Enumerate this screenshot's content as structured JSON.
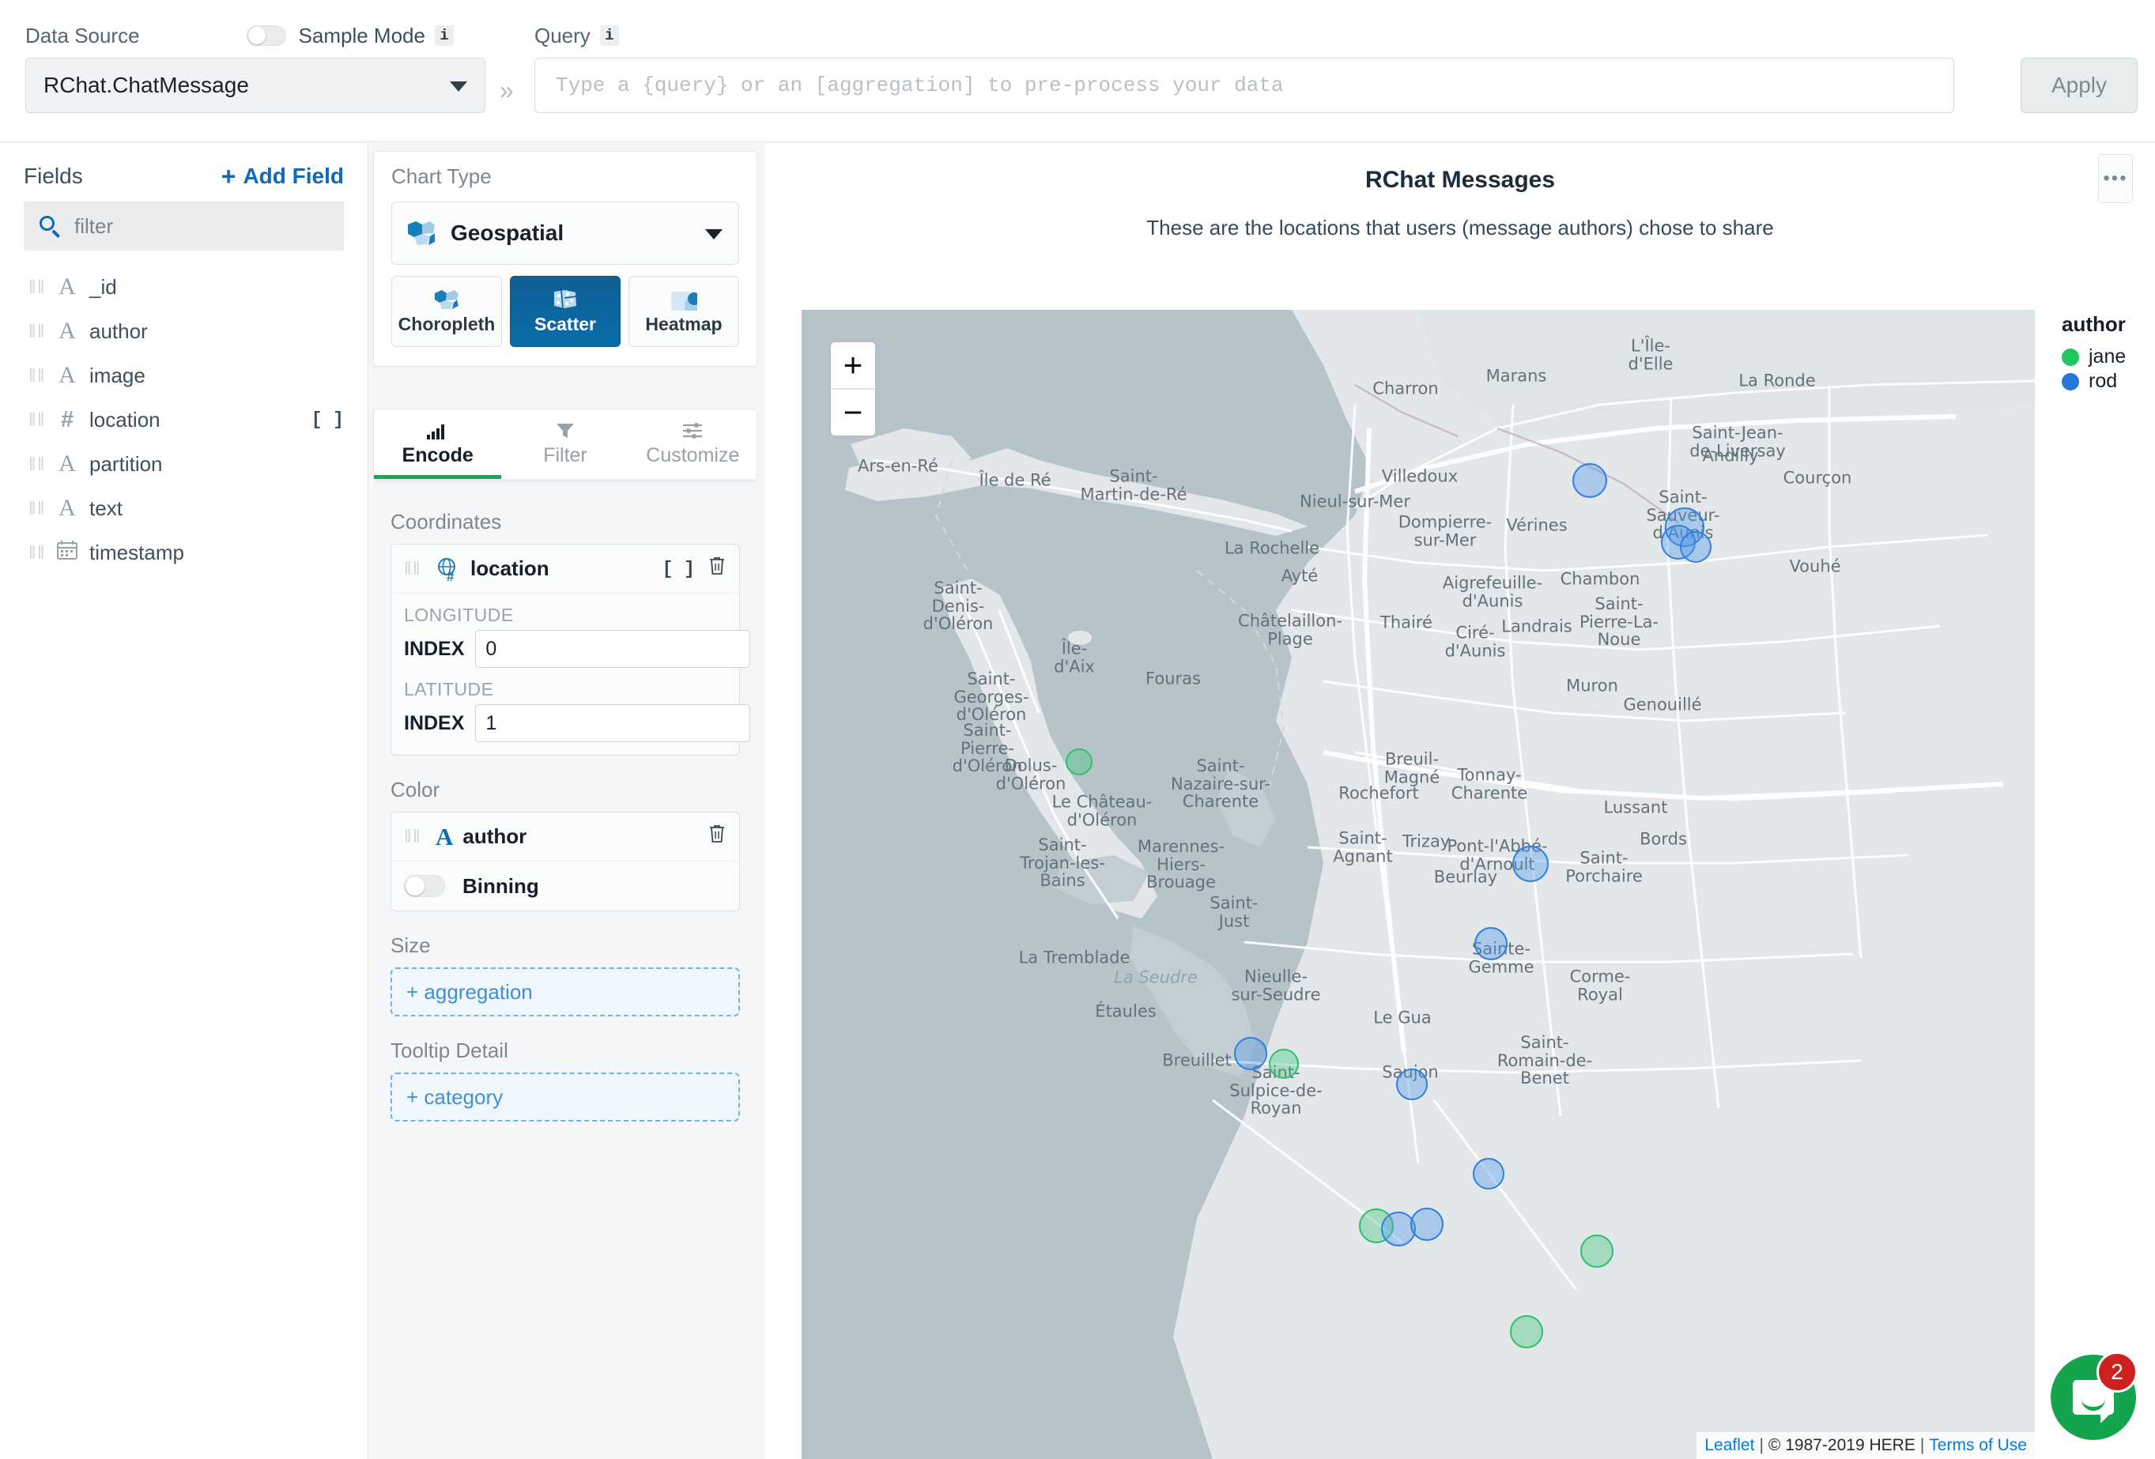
{
  "topbar": {
    "data_source_label": "Data Source",
    "sample_mode_label": "Sample Mode",
    "sample_mode_on": false,
    "info_glyph": "i",
    "data_source_value": "RChat.ChatMessage",
    "chevron_glyph": "»",
    "query_label": "Query",
    "query_value": "",
    "query_placeholder": "Type a {query} or an [aggregation] to pre-process your data",
    "apply_label": "Apply"
  },
  "fields": {
    "title": "Fields",
    "add_field_label": "Add Field",
    "plus_glyph": "+",
    "filter_placeholder": "filter",
    "grip_glyph": "‖‖",
    "items": [
      {
        "name": "_id",
        "type_glyph": "A",
        "type_class": "serif",
        "array": ""
      },
      {
        "name": "author",
        "type_glyph": "A",
        "type_class": "serif",
        "array": ""
      },
      {
        "name": "image",
        "type_glyph": "A",
        "type_class": "serif",
        "array": ""
      },
      {
        "name": "location",
        "type_glyph": "#",
        "type_class": "hash",
        "array": "[ ]"
      },
      {
        "name": "partition",
        "type_glyph": "A",
        "type_class": "serif",
        "array": ""
      },
      {
        "name": "text",
        "type_glyph": "A",
        "type_class": "serif",
        "array": ""
      },
      {
        "name": "timestamp",
        "type_glyph": "▦",
        "type_class": "cal",
        "array": ""
      }
    ]
  },
  "chart_type": {
    "title": "Chart Type",
    "selected": "Geospatial",
    "options": [
      {
        "label": "Choropleth",
        "active": false
      },
      {
        "label": "Scatter",
        "active": true
      },
      {
        "label": "Heatmap",
        "active": false
      }
    ]
  },
  "tabs": [
    {
      "label": "Encode",
      "active": true
    },
    {
      "label": "Filter",
      "active": false
    },
    {
      "label": "Customize",
      "active": false
    }
  ],
  "encode": {
    "coordinates_title": "Coordinates",
    "coord_field": "location",
    "coord_array_glyph": "[ ]",
    "trash_glyph": "🗑",
    "longitude_label": "LONGITUDE",
    "longitude_index_label": "INDEX",
    "longitude_index_value": "0",
    "latitude_label": "LATITUDE",
    "latitude_index_label": "INDEX",
    "latitude_index_value": "1",
    "color_title": "Color",
    "color_field": "author",
    "binning_label": "Binning",
    "binning_on": false,
    "size_title": "Size",
    "size_placeholder": "+ aggregation",
    "tooltip_title": "Tooltip Detail",
    "tooltip_placeholder": "+ category"
  },
  "chart": {
    "title": "RChat Messages",
    "subtitle": "These are the locations that users (message authors) chose to share",
    "menu_glyph": "•••",
    "zoom_in": "+",
    "zoom_out": "−"
  },
  "legend": {
    "title": "author",
    "items": [
      {
        "label": "jane",
        "color": "#22c55e"
      },
      {
        "label": "rod",
        "color": "#2576dd"
      }
    ]
  },
  "attribution": {
    "leaflet": "Leaflet",
    "copyright": "© 1987-2019 HERE",
    "terms": "Terms of Use",
    "sep": "|"
  },
  "chat_widget": {
    "badge_count": "2"
  },
  "chart_data": {
    "type": "scatter",
    "title": "RChat Messages",
    "subtitle": "These are the locations that users (message authors) chose to share",
    "legend_title": "author",
    "legend_position": "right",
    "series": [
      {
        "name": "jane",
        "color": "#22c55e"
      },
      {
        "name": "rod",
        "color": "#2576dd"
      }
    ],
    "basemap": "HERE streets (grayscale)",
    "points": [
      {
        "author": "rod",
        "x": 0.059,
        "y": 0.1555,
        "r": 22
      },
      {
        "author": "rod",
        "x": 0.0805,
        "y": 0.175,
        "r": 25
      },
      {
        "author": "rod",
        "x": 0.079,
        "y": 0.181,
        "r": 22
      },
      {
        "author": "rod",
        "x": 0.083,
        "y": 0.183,
        "r": 20
      },
      {
        "author": "jane",
        "x": -0.057,
        "y": 0.272,
        "r": 17
      },
      {
        "author": "rod",
        "x": 0.0455,
        "y": 0.314,
        "r": 23
      },
      {
        "author": "rod",
        "x": 0.0365,
        "y": 0.347,
        "r": 21
      },
      {
        "author": "jane",
        "x": -0.0105,
        "y": 0.3965,
        "r": 19
      },
      {
        "author": "rod",
        "x": -0.018,
        "y": 0.3925,
        "r": 21
      },
      {
        "author": "rod",
        "x": 0.0185,
        "y": 0.405,
        "r": 20
      },
      {
        "author": "rod",
        "x": 0.036,
        "y": 0.442,
        "r": 20
      },
      {
        "author": "jane",
        "x": 0.0105,
        "y": 0.4635,
        "r": 22
      },
      {
        "author": "rod",
        "x": 0.0155,
        "y": 0.465,
        "r": 22
      },
      {
        "author": "rod",
        "x": 0.022,
        "y": 0.463,
        "r": 21
      },
      {
        "author": "jane",
        "x": 0.0605,
        "y": 0.474,
        "r": 21
      },
      {
        "author": "jane",
        "x": 0.0445,
        "y": 0.5075,
        "r": 21
      }
    ],
    "map_labels": [
      {
        "t": "Ars-en-Ré",
        "x": 122,
        "y": 198
      },
      {
        "t": "Île de Ré",
        "x": 270,
        "y": 216
      },
      {
        "t": "Saint-\nMartin-de-Ré",
        "x": 420,
        "y": 222
      },
      {
        "t": "Charron",
        "x": 764,
        "y": 100
      },
      {
        "t": "Marans",
        "x": 904,
        "y": 84
      },
      {
        "t": "L'Île-\nd'Elle",
        "x": 1074,
        "y": 57
      },
      {
        "t": "La Ronde",
        "x": 1234,
        "y": 90
      },
      {
        "t": "Saint-Jean-\nde-Liversay",
        "x": 1184,
        "y": 167
      },
      {
        "t": "Andilly",
        "x": 1175,
        "y": 185
      },
      {
        "t": "Villedoux",
        "x": 782,
        "y": 211
      },
      {
        "t": "Courçon",
        "x": 1285,
        "y": 213
      },
      {
        "t": "Nieul-sur-Mer",
        "x": 700,
        "y": 243
      },
      {
        "t": "Dompierre-\nsur-Mer",
        "x": 814,
        "y": 280
      },
      {
        "t": "Vérines",
        "x": 930,
        "y": 273
      },
      {
        "t": "Saint-\nSauveur-\nd'Aunis",
        "x": 1115,
        "y": 260
      },
      {
        "t": "La Rochelle",
        "x": 595,
        "y": 302
      },
      {
        "t": "Ayté",
        "x": 630,
        "y": 337
      },
      {
        "t": "Vouhé",
        "x": 1282,
        "y": 325
      },
      {
        "t": "Aigrefeuille-\nd'Aunis",
        "x": 874,
        "y": 357
      },
      {
        "t": "Chambon",
        "x": 1010,
        "y": 341
      },
      {
        "t": "Châtelaillon-\nPlage",
        "x": 618,
        "y": 405
      },
      {
        "t": "Thairé",
        "x": 765,
        "y": 396
      },
      {
        "t": "Ciré-\nd'Aunis",
        "x": 852,
        "y": 420
      },
      {
        "t": "Landrais",
        "x": 930,
        "y": 401
      },
      {
        "t": "Saint-\nPierre-La-\nNoue",
        "x": 1034,
        "y": 395
      },
      {
        "t": "Muron",
        "x": 1000,
        "y": 476
      },
      {
        "t": "Genouillé",
        "x": 1089,
        "y": 500
      },
      {
        "t": "Île-\nd'Aix",
        "x": 345,
        "y": 440
      },
      {
        "t": "Fouras",
        "x": 470,
        "y": 467
      },
      {
        "t": "Breuil-\nMagné",
        "x": 772,
        "y": 580
      },
      {
        "t": "Lussant",
        "x": 1055,
        "y": 630
      },
      {
        "t": "Saint-\nDenis-\nd'Oléron",
        "x": 198,
        "y": 375
      },
      {
        "t": "Saint-\nGeorges-\nd'Oléron",
        "x": 240,
        "y": 490
      },
      {
        "t": "Saint-\nPierre-\nd'Oléron",
        "x": 235,
        "y": 555
      },
      {
        "t": "Dolus-\nd'Oléron",
        "x": 290,
        "y": 588
      },
      {
        "t": "Le Château-\nd'Oléron",
        "x": 380,
        "y": 634
      },
      {
        "t": "Saint-\nTrojan-les-\nBains",
        "x": 330,
        "y": 700
      },
      {
        "t": "Saint-\nNazaire-sur-\nCharente",
        "x": 530,
        "y": 600
      },
      {
        "t": "Rochefort",
        "x": 730,
        "y": 612
      },
      {
        "t": "Tonnay-\nCharente",
        "x": 870,
        "y": 600
      },
      {
        "t": "Marennes-\nHiers-\nBrouage",
        "x": 480,
        "y": 702
      },
      {
        "t": "Saint-\nJust",
        "x": 547,
        "y": 762
      },
      {
        "t": "Pont-l'Abbé-\nd'Arnoult",
        "x": 880,
        "y": 690
      },
      {
        "t": "Saint-\nPorchaire",
        "x": 1015,
        "y": 705
      },
      {
        "t": "Trizay",
        "x": 790,
        "y": 673
      },
      {
        "t": "Beurlay",
        "x": 840,
        "y": 718
      },
      {
        "t": "Bords",
        "x": 1090,
        "y": 670
      },
      {
        "t": "Saint-\nAgnant",
        "x": 710,
        "y": 680
      },
      {
        "t": "Sainte-\nGemme",
        "x": 885,
        "y": 820
      },
      {
        "t": "Corme-\nRoyal",
        "x": 1010,
        "y": 855
      },
      {
        "t": "La Tremblade",
        "x": 345,
        "y": 820
      },
      {
        "t": "La Seudre",
        "x": 448,
        "y": 845,
        "water": true
      },
      {
        "t": "Nieulle-\nsur-Seudre",
        "x": 600,
        "y": 855
      },
      {
        "t": "Étaules",
        "x": 410,
        "y": 888
      },
      {
        "t": "Le Gua",
        "x": 760,
        "y": 896
      },
      {
        "t": "Breuillet",
        "x": 500,
        "y": 950
      },
      {
        "t": "Saint-\nSulpice-de-\nRoyan",
        "x": 600,
        "y": 988
      },
      {
        "t": "Saujon",
        "x": 770,
        "y": 965
      },
      {
        "t": "Saint-\nRomain-de-\nBenet",
        "x": 940,
        "y": 950
      }
    ]
  }
}
